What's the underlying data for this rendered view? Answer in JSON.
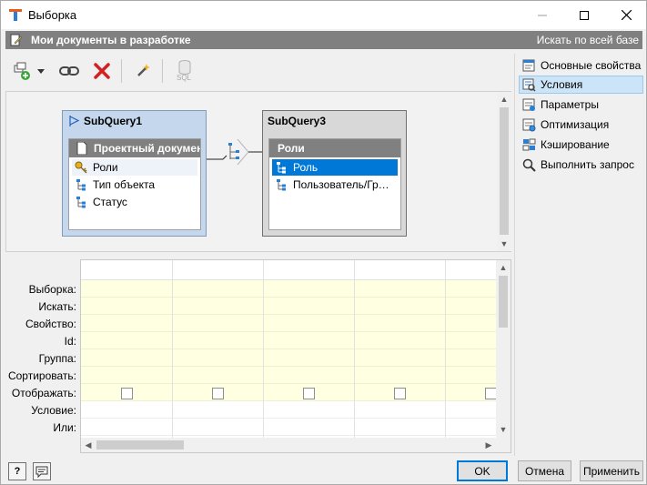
{
  "window": {
    "title": "Выборка"
  },
  "header": {
    "title": "Мои документы в разработке",
    "search_label": "Искать по всей базе"
  },
  "toolbar": {
    "sql_label": "SQL"
  },
  "diagram": {
    "queries": [
      {
        "title": "SubQuery1",
        "table": {
          "name": "Проектный документ",
          "fields": [
            "Роли",
            "Тип объекта",
            "Статус"
          ]
        }
      },
      {
        "title": "SubQuery3",
        "table": {
          "name": "Роли",
          "fields": [
            "Роль",
            "Пользователь/Группа"
          ]
        }
      }
    ]
  },
  "grid": {
    "row_labels": [
      "Выборка:",
      "Искать:",
      "Свойство:",
      "Id:",
      "Группа:",
      "Сортировать:",
      "Отображать:",
      "Условие:",
      "Или:"
    ]
  },
  "side_panel": {
    "items": [
      "Основные свойства",
      "Условия",
      "Параметры",
      "Оптимизация",
      "Кэширование",
      "Выполнить запрос"
    ],
    "active_index": 1
  },
  "buttons": {
    "ok": "OK",
    "cancel": "Отмена",
    "apply": "Применить",
    "help": "?"
  },
  "colors": {
    "accent": "#0078d7",
    "header_bg": "#808080",
    "grid_row_bg": "#ffffe1",
    "selected_side_bg": "#cce4f7"
  }
}
